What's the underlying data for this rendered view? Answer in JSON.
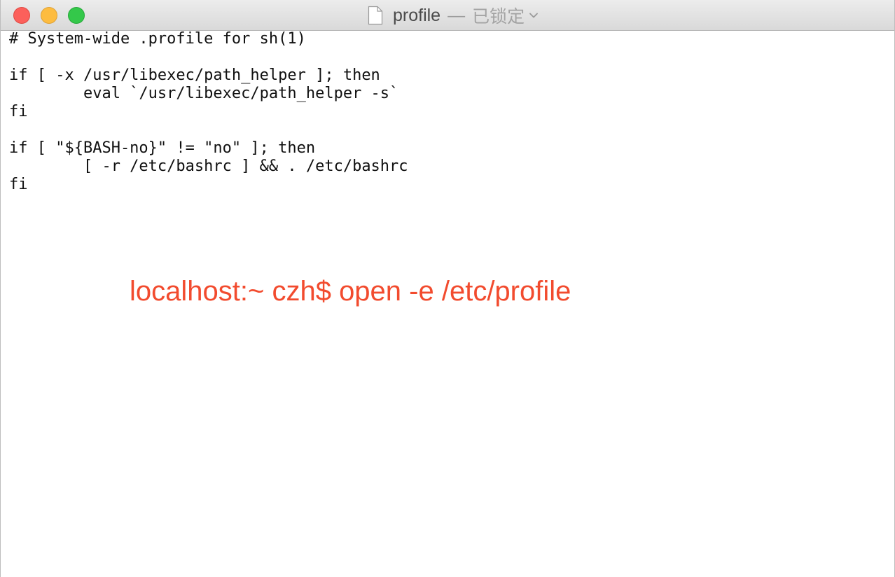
{
  "window": {
    "title_name": "profile",
    "title_separator": "—",
    "title_status": "已锁定",
    "icons": {
      "document": "document-icon",
      "chevron": "chevron-down-icon"
    },
    "colors": {
      "close": "#fc605b",
      "minimize": "#fdbc40",
      "zoom": "#34c84a"
    }
  },
  "editor": {
    "lines": [
      "# System-wide .profile for sh(1)",
      "",
      "if [ -x /usr/libexec/path_helper ]; then",
      "        eval `/usr/libexec/path_helper -s`",
      "fi",
      "",
      "if [ \"${BASH-no}\" != \"no\" ]; then",
      "        [ -r /etc/bashrc ] && . /etc/bashrc",
      "fi"
    ]
  },
  "annotation": {
    "text": "localhost:~ czh$ open -e /etc/profile",
    "color": "#f24b2e"
  }
}
